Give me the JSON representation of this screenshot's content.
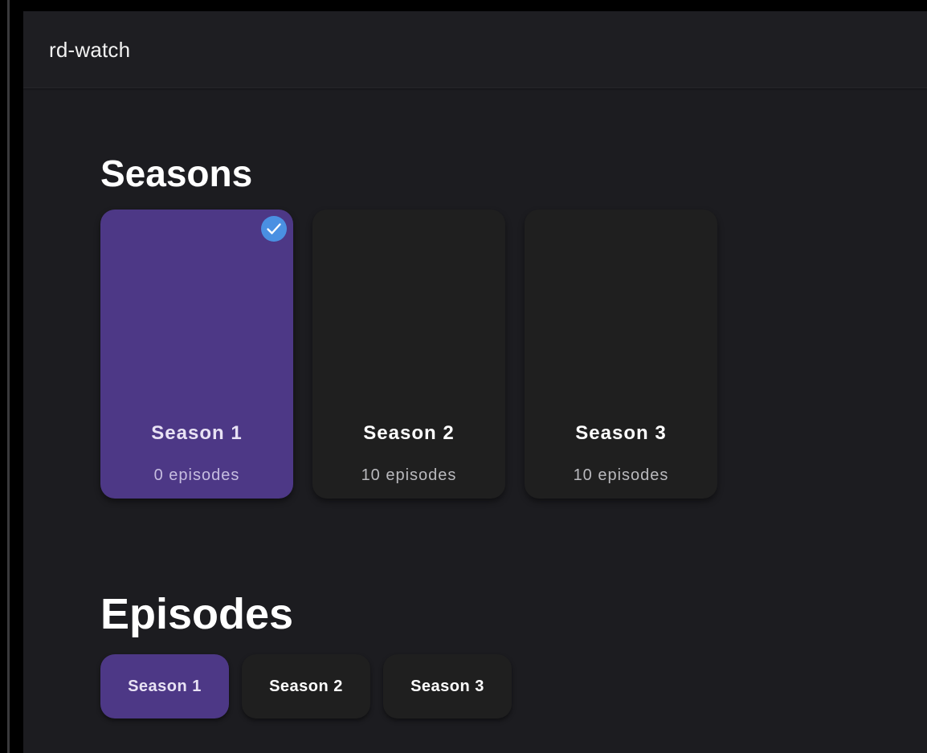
{
  "app": {
    "title": "rd-watch"
  },
  "seasons": {
    "heading": "Seasons",
    "items": [
      {
        "name": "Season 1",
        "episodes": "0 episodes",
        "selected": true
      },
      {
        "name": "Season 2",
        "episodes": "10 episodes",
        "selected": false
      },
      {
        "name": "Season 3",
        "episodes": "10 episodes",
        "selected": false
      }
    ]
  },
  "episodes": {
    "heading": "Episodes",
    "tabs": [
      {
        "label": "Season 1",
        "active": true
      },
      {
        "label": "Season 2",
        "active": false
      },
      {
        "label": "Season 3",
        "active": false
      }
    ]
  },
  "icons": {
    "selected_badge": "check-icon"
  },
  "colors": {
    "accent": "#4d3886",
    "badge": "#4a90e2",
    "background": "#1c1c20",
    "card": "#1f1f1f"
  }
}
